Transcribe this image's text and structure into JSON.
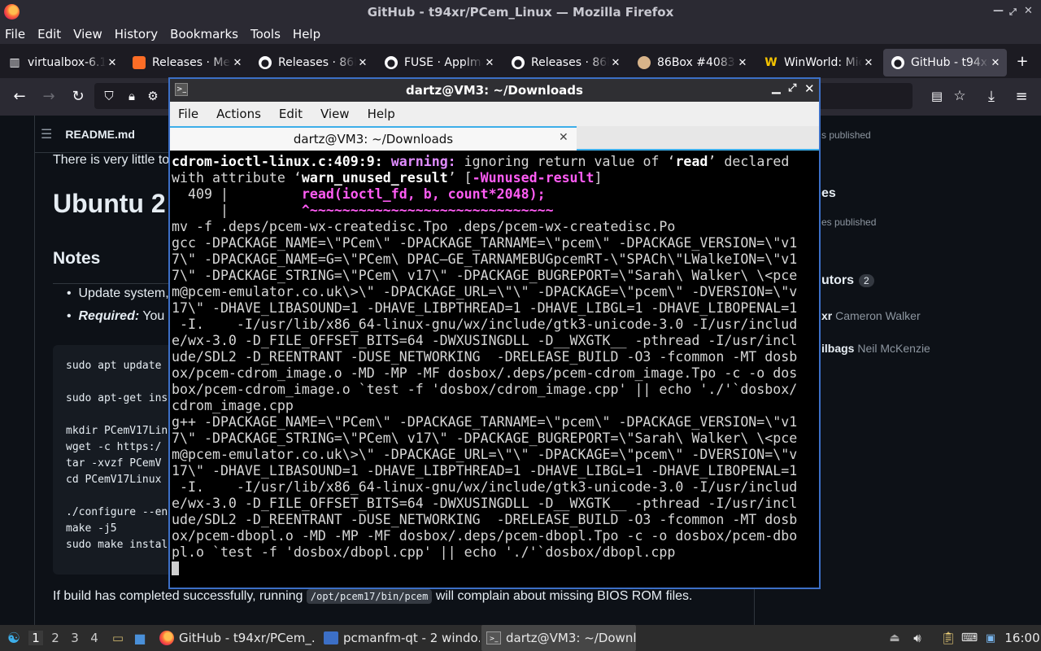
{
  "firefox": {
    "window_title": "GitHub - t94xr/PCem_Linux — Mozilla Firefox",
    "menus": [
      "File",
      "Edit",
      "View",
      "History",
      "Bookmarks",
      "Tools",
      "Help"
    ],
    "tabs": [
      {
        "title": "virtualbox-6.1.",
        "icon": "columns-icon"
      },
      {
        "title": "Releases · Meli",
        "icon": "gitlab-icon"
      },
      {
        "title": "Releases · 86B",
        "icon": "github-icon"
      },
      {
        "title": "FUSE · AppIma",
        "icon": "github-icon"
      },
      {
        "title": "Releases · 86B",
        "icon": "github-icon"
      },
      {
        "title": "86Box #4083 |",
        "icon": "jenkins-icon"
      },
      {
        "title": "WinWorld: Micr",
        "icon": "winworld-icon"
      },
      {
        "title": "GitHub - t94xr/",
        "icon": "github-icon",
        "active": true
      }
    ]
  },
  "github": {
    "readme_filename": "README.md",
    "intro_text": "There is very little to",
    "heading_ubuntu": "Ubuntu 2",
    "heading_notes": "Notes",
    "bullet1": "Update system,",
    "bullet2_label": "Required:",
    "bullet2_text": " You",
    "code_lines": [
      "sudo apt update",
      "",
      "sudo apt-get ins",
      "",
      "mkdir PCemV17Lin",
      "wget -c https:/",
      "tar -xvzf PCemV",
      "cd PCemV17Linux",
      "",
      "./configure --en",
      "make -j5",
      "sudo make instal"
    ],
    "footer_before": "If build has completed successfully, running ",
    "footer_code": "/opt/pcem17/bin/pcem",
    "footer_after": " will complain about missing BIOS ROM files.",
    "sidebar": {
      "packages_text": "s published",
      "releases_heading": "es",
      "releases_text": "es published",
      "contributors_heading": "utors",
      "contributors_count": "2",
      "contributor1_user": "xr",
      "contributor1_name": "Cameron Walker",
      "contributor2_user": "ilbags",
      "contributor2_name": "Neil McKenzie"
    }
  },
  "terminal": {
    "window_title": "dartz@VM3: ~/Downloads",
    "tab_title": "dartz@VM3: ~/Downloads",
    "menus": [
      "File",
      "Actions",
      "Edit",
      "View",
      "Help"
    ],
    "w1_loc": "cdrom-ioctl-linux.c:409:9:",
    "w1_warn": "warning:",
    "w1_a": " ignoring return value of ‘",
    "w1_read": "read",
    "w1_b": "’ declared",
    "w2_a": "with attribute ‘",
    "w2_attr": "warn_unused_result",
    "w2_b": "’ [",
    "w2_flag": "-Wunused-result",
    "w2_c": "]",
    "w3_a": "  409 |         ",
    "w3_code": "read(ioctl_fd, b, count*2048);",
    "w4_a": "      |         ",
    "w4_code": "^~~~~~~~~~~~~~~~~~~~~~~~~~~~~~~",
    "lines": [
      "mv -f .deps/pcem-wx-createdisc.Tpo .deps/pcem-wx-createdisc.Po",
      "gcc -DPACKAGE_NAME=\\\"PCem\\\" -DPACKAGE_TARNAME=\\\"pcem\\\" -DPACKAGE_VERSION=\\\"v1",
      "7\\\" -DPACKAGE_NAME=G=\\\"PCem\\ DPAC—GE_TARNAMEBUGpcemRT-\\\"SPACh\\\"LWalkeION=\\\"v1",
      "7\\\" -DPACKAGE_STRING=\\\"PCem\\ v17\\\" -DPACKAGE_BUGREPORT=\\\"Sarah\\ Walker\\ \\<pce",
      "m@pcem-emulator.co.uk\\>\\\" -DPACKAGE_URL=\\\"\\\" -DPACKAGE=\\\"pcem\\\" -DVERSION=\\\"v",
      "17\\\" -DHAVE_LIBASOUND=1 -DHAVE_LIBPTHREAD=1 -DHAVE_LIBGL=1 -DHAVE_LIBOPENAL=1",
      " -I.    -I/usr/lib/x86_64-linux-gnu/wx/include/gtk3-unicode-3.0 -I/usr/includ",
      "e/wx-3.0 -D_FILE_OFFSET_BITS=64 -DWXUSINGDLL -D__WXGTK__ -pthread -I/usr/incl",
      "ude/SDL2 -D_REENTRANT -DUSE_NETWORKING  -DRELEASE_BUILD -O3 -fcommon -MT dosb",
      "ox/pcem-cdrom_image.o -MD -MP -MF dosbox/.deps/pcem-cdrom_image.Tpo -c -o dos",
      "box/pcem-cdrom_image.o `test -f 'dosbox/cdrom_image.cpp' || echo './'`dosbox/",
      "cdrom_image.cpp",
      "g++ -DPACKAGE_NAME=\\\"PCem\\\" -DPACKAGE_TARNAME=\\\"pcem\\\" -DPACKAGE_VERSION=\\\"v1",
      "7\\\" -DPACKAGE_STRING=\\\"PCem\\ v17\\\" -DPACKAGE_BUGREPORT=\\\"Sarah\\ Walker\\ \\<pce",
      "m@pcem-emulator.co.uk\\>\\\" -DPACKAGE_URL=\\\"\\\" -DPACKAGE=\\\"pcem\\\" -DVERSION=\\\"v",
      "17\\\" -DHAVE_LIBASOUND=1 -DHAVE_LIBPTHREAD=1 -DHAVE_LIBGL=1 -DHAVE_LIBOPENAL=1",
      " -I.    -I/usr/lib/x86_64-linux-gnu/wx/include/gtk3-unicode-3.0 -I/usr/includ",
      "e/wx-3.0 -D_FILE_OFFSET_BITS=64 -DWXUSINGDLL -D__WXGTK__ -pthread -I/usr/incl",
      "ude/SDL2 -D_REENTRANT -DUSE_NETWORKING  -DRELEASE_BUILD -O3 -fcommon -MT dosb",
      "ox/pcem-dbopl.o -MD -MP -MF dosbox/.deps/pcem-dbopl.Tpo -c -o dosbox/pcem-dbo",
      "pl.o `test -f 'dosbox/dbopl.cpp' || echo './'`dosbox/dbopl.cpp"
    ]
  },
  "taskbar": {
    "workspaces": [
      "1",
      "2",
      "3",
      "4"
    ],
    "tasks": [
      {
        "label": "GitHub - t94xr/PCem_...",
        "icon": "firefox-icon"
      },
      {
        "label": "pcmanfm-qt - 2 windo...",
        "icon": "folder-icon"
      },
      {
        "label": "dartz@VM3: ~/Downl...",
        "icon": "terminal-icon",
        "active": true
      }
    ],
    "clock": "16:00"
  },
  "colors": {
    "terminal_warning": "#e08cff",
    "terminal_highlight": "#ff5cf4",
    "accent_blue": "#3daee9"
  }
}
